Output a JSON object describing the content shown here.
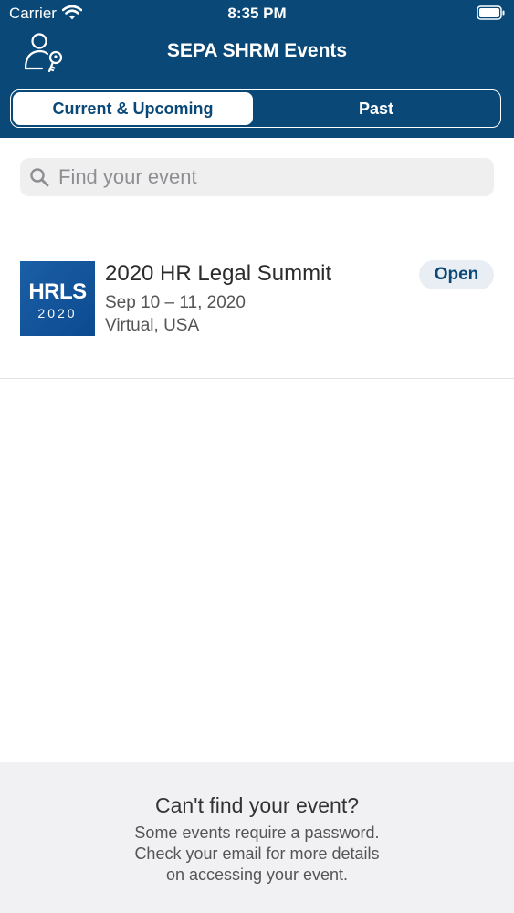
{
  "status_bar": {
    "carrier": "Carrier",
    "time": "8:35 PM"
  },
  "header": {
    "title": "SEPA SHRM Events",
    "tabs": [
      {
        "label": "Current & Upcoming",
        "selected": true
      },
      {
        "label": "Past",
        "selected": false
      }
    ]
  },
  "search": {
    "placeholder": "Find your event",
    "value": ""
  },
  "events": [
    {
      "logo_text": "HRLS",
      "logo_year": "2020",
      "title": "2020 HR Legal Summit",
      "dates": "Sep 10 – 11, 2020",
      "location": "Virtual, USA",
      "status": "Open"
    }
  ],
  "footer": {
    "title": "Can't find your event?",
    "lines": [
      "Some events require a password.",
      "Check your email for more details",
      "on accessing your event."
    ]
  },
  "colors": {
    "brand": "#0a4878",
    "badge_bg": "#e8eef3",
    "footer_bg": "#f1f1f3"
  }
}
